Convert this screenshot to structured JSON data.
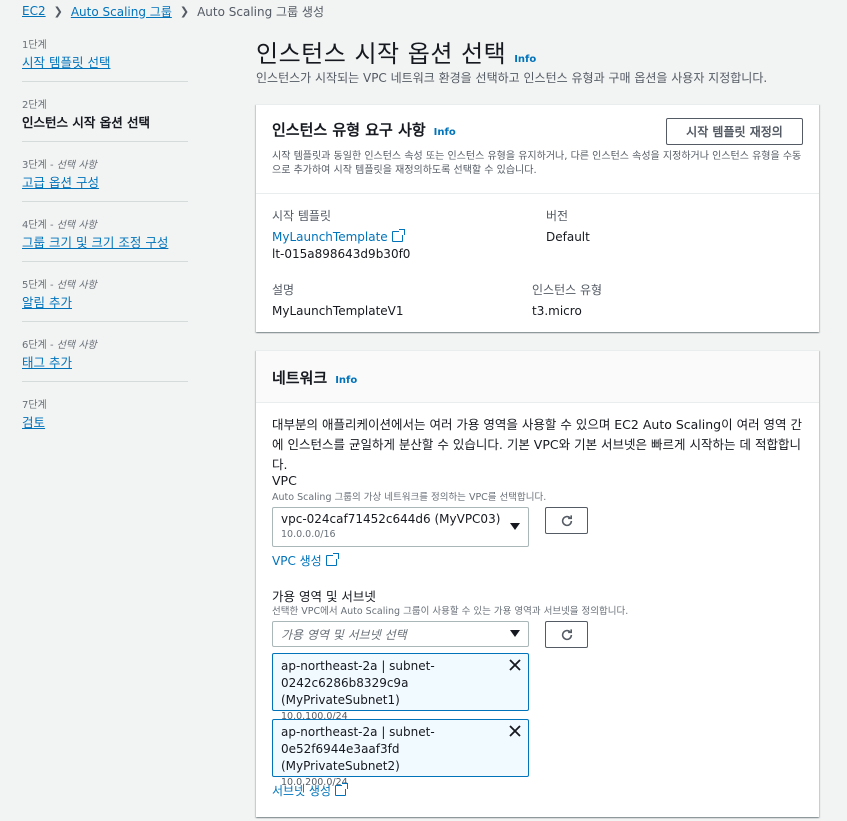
{
  "breadcrumb": {
    "ec2": "EC2",
    "asg": "Auto Scaling 그룹",
    "current": "Auto Scaling 그룹 생성"
  },
  "steps": [
    {
      "num": "1단계",
      "optional": "",
      "title": "시작 템플릿 선택"
    },
    {
      "num": "2단계",
      "optional": "",
      "title": "인스턴스 시작 옵션 선택"
    },
    {
      "num": "3단계 - ",
      "optional": "선택 사항",
      "title": "고급 옵션 구성"
    },
    {
      "num": "4단계 - ",
      "optional": "선택 사항",
      "title": "그룹 크기 및 크기 조정 구성"
    },
    {
      "num": "5단계 - ",
      "optional": "선택 사항",
      "title": "알림 추가"
    },
    {
      "num": "6단계 - ",
      "optional": "선택 사항",
      "title": "태그 추가"
    },
    {
      "num": "7단계",
      "optional": "",
      "title": "검토"
    }
  ],
  "page": {
    "title": "인스턴스 시작 옵션 선택",
    "info": "Info",
    "description": "인스턴스가 시작되는 VPC 네트워크 환경을 선택하고 인스턴스 유형과 구매 옵션을 사용자 지정합니다."
  },
  "requirements": {
    "title": "인스턴스 유형 요구 사항",
    "info": "Info",
    "description": "시작 템플릿과 동일한 인스턴스 속성 또는 인스턴스 유형을 유지하거나, 다른 인스턴스 속성을 지정하거나 인스턴스 유형을 수동으로 추가하여 시작 템플릿을 재정의하도록 선택할 수 있습니다.",
    "override_button": "시작 템플릿 재정의",
    "launch_template_label": "시작 템플릿",
    "launch_template_name": "MyLaunchTemplate",
    "launch_template_id": "lt-015a898643d9b30f0",
    "version_label": "버전",
    "version_value": "Default",
    "description_label": "설명",
    "description_value": "MyLaunchTemplateV1",
    "instance_type_label": "인스턴스 유형",
    "instance_type_value": "t3.micro"
  },
  "network": {
    "title": "네트워크",
    "info": "Info",
    "description": "대부분의 애플리케이션에서는 여러 가용 영역을 사용할 수 있으며 EC2 Auto Scaling이 여러 영역 간에 인스턴스를 균일하게 분산할 수 있습니다. 기본 VPC와 기본 서브넷은 빠르게 시작하는 데 적합합니다.",
    "vpc_label": "VPC",
    "vpc_desc": "Auto Scaling 그룹의 가상 네트워크를 정의하는 VPC를 선택합니다.",
    "vpc_selected": "vpc-024caf71452c644d6 (MyVPC03)",
    "vpc_cidr": "10.0.0.0/16",
    "create_vpc": "VPC 생성",
    "az_label": "가용 영역 및 서브넷",
    "az_desc": "선택한 VPC에서 Auto Scaling 그룹이 사용할 수 있는 가용 영역과 서브넷을 정의합니다.",
    "az_placeholder": "가용 영역 및 서브넷 선택",
    "subnets": [
      {
        "line1": "ap-northeast-2a | subnet-0242c6286b8329c9a (MyPrivateSubnet1)",
        "cidr": "10.0.100.0/24"
      },
      {
        "line1": "ap-northeast-2a | subnet-0e52f6944e3aaf3fd (MyPrivateSubnet2)",
        "cidr": "10.0.200.0/24"
      }
    ],
    "create_subnet": "서브넷 생성"
  }
}
